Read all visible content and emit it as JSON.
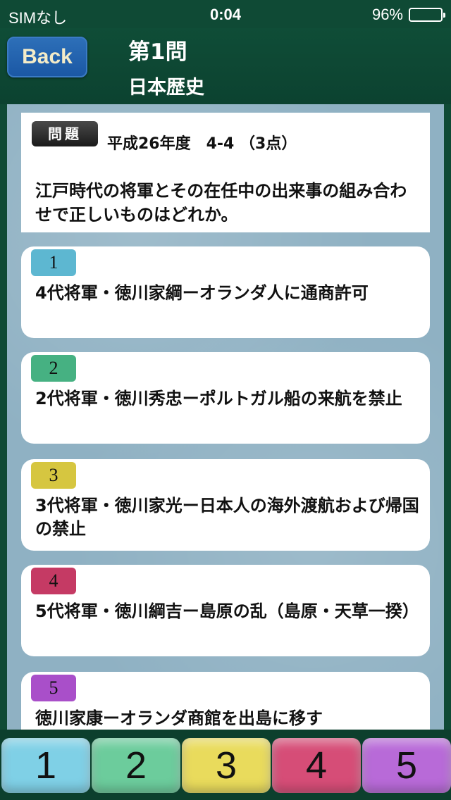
{
  "status_bar": {
    "carrier": "SIMなし",
    "time": "0:04",
    "battery": "96%"
  },
  "nav": {
    "back_label": "Back",
    "title": "第1問",
    "subtitle": "日本歴史"
  },
  "question": {
    "tag": "問題",
    "meta": "平成26年度　4-4 （3点）",
    "text": "江戸時代の将軍とその在任中の出来事の組み合わせで正しいものはどれか。"
  },
  "choices": [
    {
      "number": "1",
      "text": "4代将軍・徳川家綱ーオランダ人に通商許可",
      "color": "#5db7d1"
    },
    {
      "number": "2",
      "text": "2代将軍・徳川秀忠ーポルトガル船の来航を禁止",
      "color": "#46b182"
    },
    {
      "number": "3",
      "text": "3代将軍・徳川家光ー日本人の海外渡航および帰国の禁止",
      "color": "#d6c640"
    },
    {
      "number": "4",
      "text": "5代将軍・徳川綱吉ー島原の乱（島原・天草一揆）",
      "color": "#c53a64"
    },
    {
      "number": "5",
      "text": "徳川家康ーオランダ商館を出島に移す",
      "color": "#a94fc9"
    }
  ],
  "answer_buttons": [
    {
      "label": "1",
      "color": "#7fd0e6"
    },
    {
      "label": "2",
      "color": "#6ccc9c"
    },
    {
      "label": "3",
      "color": "#e9db5c"
    },
    {
      "label": "4",
      "color": "#d64d77"
    },
    {
      "label": "5",
      "color": "#b86ad8"
    }
  ]
}
